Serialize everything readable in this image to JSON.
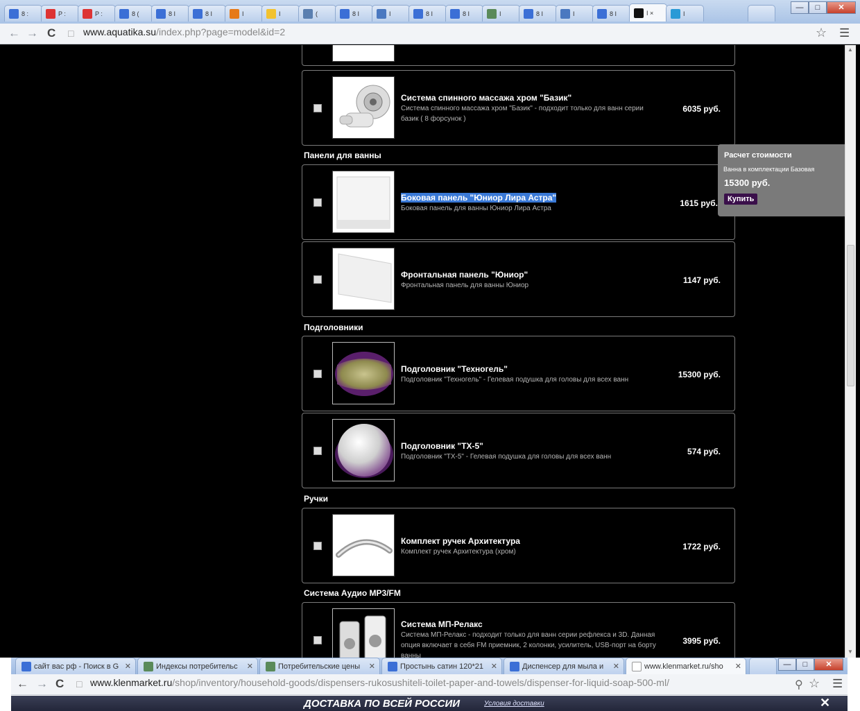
{
  "top_browser": {
    "tabs": [
      {
        "label": "8 :",
        "color": "#3b6fd6"
      },
      {
        "label": "P :",
        "color": "#d33"
      },
      {
        "label": "P :",
        "color": "#d33"
      },
      {
        "label": "8 (",
        "color": "#3b6fd6"
      },
      {
        "label": "8 I",
        "color": "#3b6fd6"
      },
      {
        "label": "8 I",
        "color": "#3b6fd6"
      },
      {
        "label": "I",
        "color": "#e67a1a"
      },
      {
        "label": "I",
        "color": "#f2c230"
      },
      {
        "label": "(",
        "color": "#5a7fb0"
      },
      {
        "label": "8 I",
        "color": "#3b6fd6"
      },
      {
        "label": "I",
        "color": "#4a78c0"
      },
      {
        "label": "8 I",
        "color": "#3b6fd6"
      },
      {
        "label": "8 I",
        "color": "#3b6fd6"
      },
      {
        "label": "I",
        "color": "#5a8a5a"
      },
      {
        "label": "8 I",
        "color": "#3b6fd6"
      },
      {
        "label": "I",
        "color": "#4a78c0"
      },
      {
        "label": "8 I",
        "color": "#3b6fd6"
      },
      {
        "label": "I ×",
        "color": "#111"
      },
      {
        "label": "I",
        "color": "#2a9ad6"
      }
    ],
    "url_host": "www.aquatika.su",
    "url_path": "/index.php?page=model&id=2"
  },
  "sections": {
    "panels": "Панели для ванны",
    "headrests": "Подголовники",
    "handles": "Ручки",
    "audio": "Система Аудио MP3/FM"
  },
  "items": [
    {
      "title": "Система спинного массажа хром \"Базик\"",
      "desc": "Система спинного массажа хром \"Базик\" - подходит только для ванн серии базик ( 8 форсунок )",
      "price": "6035 руб."
    },
    {
      "title": "Боковая панель \"Юниор Лира Астра\"",
      "desc": "Боковая панель для ванны Юниор Лира Астра",
      "price": "1615 руб."
    },
    {
      "title": "Фронтальная панель \"Юниор\"",
      "desc": "Фронтальная панель для ванны Юниор",
      "price": "1147 руб."
    },
    {
      "title": "Подголовник \"Техногель\"",
      "desc": "Подголовник \"Техногель\" - Гелевая подушка для головы для всех ванн",
      "price": "15300 руб."
    },
    {
      "title": "Подголовник \"ТХ-5\"",
      "desc": "Подголовник \"ТХ-5\" - Гелевая подушка для головы для всех ванн",
      "price": "574 руб."
    },
    {
      "title": "Комплект ручек Архитектура",
      "desc": "Комплект ручек Архитектура (хром)",
      "price": "1722 руб."
    },
    {
      "title": "Система МП-Релакс",
      "desc": "Система МП-Релакс - подходит только для ванн серии рефлекса и 3D. Данная опция включает в себя FM приемник, 2 колонки, усилитель, USB-порт на борту ванны",
      "price": "3995 руб."
    }
  ],
  "calc_box": {
    "title": "Расчет стоимости",
    "subtitle": "Ванна в комплектации Базовая",
    "total": "15300 руб.",
    "buy": "Купить"
  },
  "bottom_browser": {
    "tabs": [
      {
        "label": "сайт вас рф - Поиск в G",
        "color": "#3b6fd6"
      },
      {
        "label": "Индексы потребительс",
        "color": "#5a8a5a"
      },
      {
        "label": "Потребительские цены",
        "color": "#5a8a5a"
      },
      {
        "label": "Простынь сатин 120*21",
        "color": "#3b6fd6"
      },
      {
        "label": "Диспенсер для мыла и",
        "color": "#3b6fd6"
      },
      {
        "label": "www.klenmarket.ru/sho",
        "color": "#ffffff"
      }
    ],
    "url_host": "www.klenmarket.ru",
    "url_path": "/shop/inventory/household-goods/dispensers-rukosushiteli-toilet-paper-and-towels/dispenser-for-liquid-soap-500-ml/",
    "banner_text": "ДОСТАВКА ПО ВСЕЙ РОССИИ",
    "banner_link": "Условия доставки"
  }
}
